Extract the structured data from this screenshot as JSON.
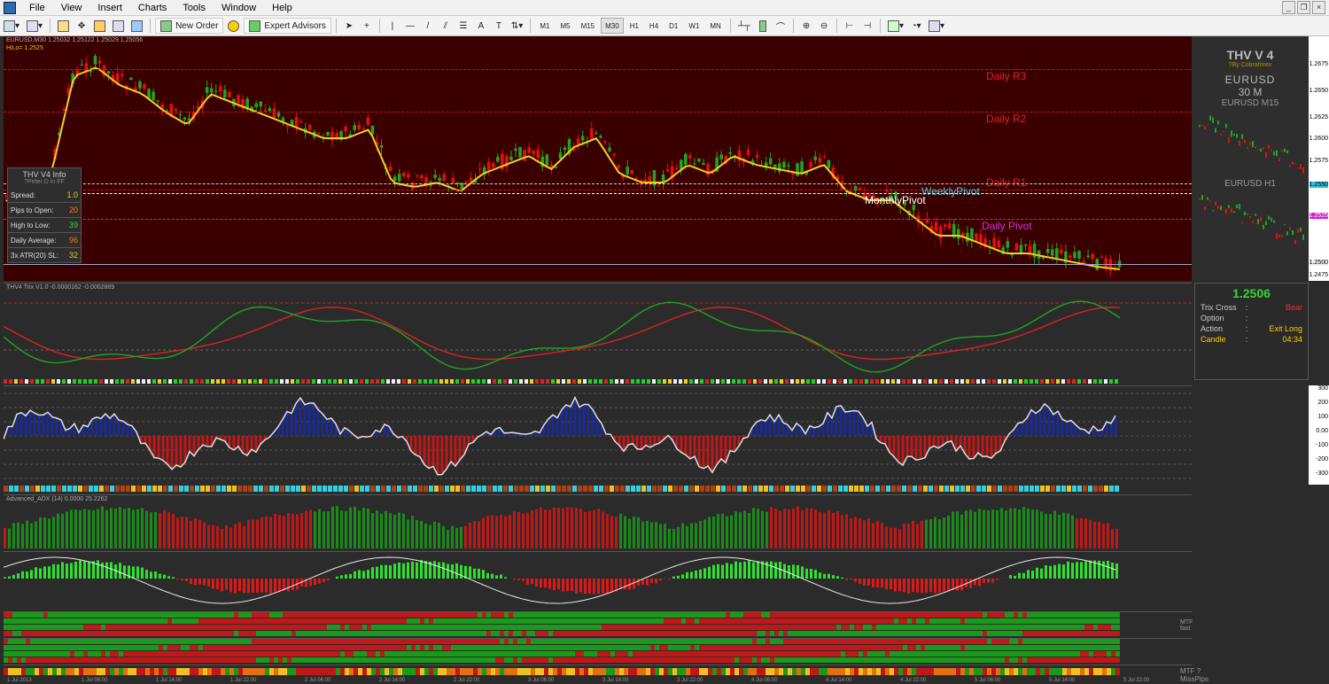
{
  "menu": {
    "items": [
      "File",
      "View",
      "Insert",
      "Charts",
      "Tools",
      "Window",
      "Help"
    ]
  },
  "toolbar": {
    "new_order": "New Order",
    "expert_advisors": "Expert Advisors",
    "timeframes": [
      "M1",
      "M5",
      "M15",
      "M30",
      "H1",
      "H4",
      "D1",
      "W1",
      "MN"
    ],
    "active_timeframe": "M30"
  },
  "main_chart": {
    "header": "EURUSD,M30  1.25032 1.25122 1.25029 1.25056",
    "hilo": "HiLo= 1.2525",
    "levels": {
      "r3": "Daily R3",
      "r2": "Daily R2",
      "r1": "Daily R1",
      "weekly": "WeeklyPivot",
      "monthly": "MonthlyPivot",
      "daily": "Daily Pivot"
    }
  },
  "info_panel": {
    "title": "THV  V4  Info",
    "subtitle": "?Peter D in FF",
    "rows": [
      {
        "label": "Spread:",
        "value": "1.0",
        "color": "#f4c430"
      },
      {
        "label": "Pips to Open:",
        "value": "20",
        "color": "#ff7a00"
      },
      {
        "label": "High to Low:",
        "value": "39",
        "color": "#3bd13b"
      },
      {
        "label": "Daily Average:",
        "value": "96",
        "color": "#ff7a00"
      },
      {
        "label": "3x ATR(20) SL:",
        "value": "32",
        "color": "#f4c430"
      }
    ]
  },
  "side_panel": {
    "title": "THV V 4",
    "by": "?By Cobraforex",
    "symbol": "EURUSD",
    "period": "30 M",
    "mini1": "EURUSD M15",
    "mini2": "EURUSD H1"
  },
  "trix_panel": {
    "price": "1.2506",
    "rows": [
      {
        "key": "Trix Cross",
        "value": "Bear",
        "color": "#ff2a2a"
      },
      {
        "key": "Option",
        "value": "",
        "color": "#ccc"
      },
      {
        "key": "Action",
        "value": "Exit Long",
        "color": "#ffcc00"
      },
      {
        "key": "Candle",
        "value": "04:34",
        "color": "#ffcc00"
      }
    ]
  },
  "panes": {
    "trix": "THV4 Trix V1.0 -0.0000162 -0.0002889",
    "adx": "Advanced_ADX (14) 0.0000 25.2262",
    "mtf1": "MTF fast",
    "mtf2": "MTF ?MissPips"
  },
  "price_scale": [
    "1.2675",
    "1.2650",
    "1.2625",
    "1.2600",
    "1.2575",
    "1.2550",
    "1.2525",
    "1.2500",
    "1.2475"
  ],
  "cci_scale": [
    "300",
    "200",
    "100",
    "0.00",
    "-100",
    "-200",
    "-300"
  ],
  "time_axis": [
    "1 Jul 2013",
    "1 Jul 06:00",
    "1 Jul 14:00",
    "1 Jul 22:00",
    "2 Jul 06:00",
    "2 Jul 14:00",
    "2 Jul 22:00",
    "3 Jul 06:00",
    "3 Jul 14:00",
    "3 Jul 22:00",
    "4 Jul 06:00",
    "4 Jul 14:00",
    "4 Jul 22:00",
    "5 Jul 06:00",
    "5 Jul 14:00",
    "5 Jul 22:00"
  ],
  "colors": {
    "bull": "#22a322",
    "bear": "#e01010",
    "ema": "#f0d020",
    "bg_main": "#3a0000"
  }
}
